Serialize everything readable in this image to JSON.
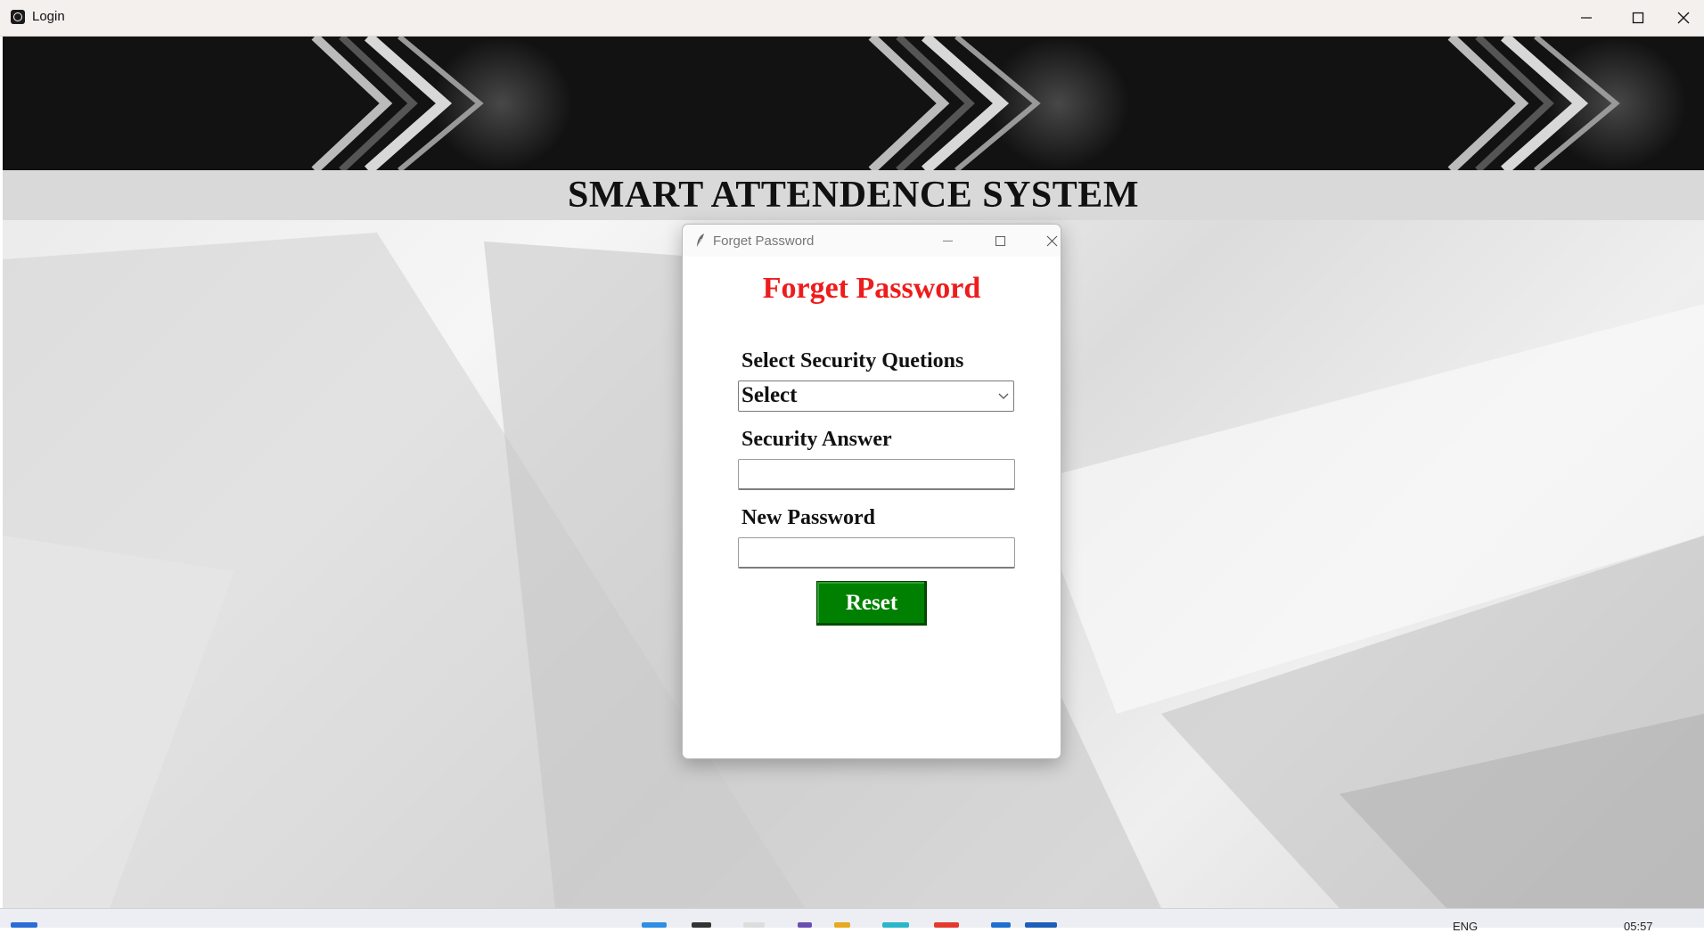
{
  "window": {
    "title": "Login",
    "minimize_icon": "minimize-icon",
    "maximize_icon": "maximize-icon",
    "close_icon": "close-icon"
  },
  "app": {
    "header_title": "SMART ATTENDENCE SYSTEM"
  },
  "dialog": {
    "window_title": "Forget Password",
    "heading": "Forget Password",
    "heading_color": "#ee1c1c",
    "security_question_label": "Select Security Quetions",
    "security_question_selected": "Select",
    "security_answer_label": "Security Answer",
    "security_answer_value": "",
    "new_password_label": "New Password",
    "new_password_value": "",
    "reset_label": "Reset",
    "reset_color": "#008000"
  },
  "taskbar": {
    "language": "ENG",
    "time": "05:57"
  }
}
